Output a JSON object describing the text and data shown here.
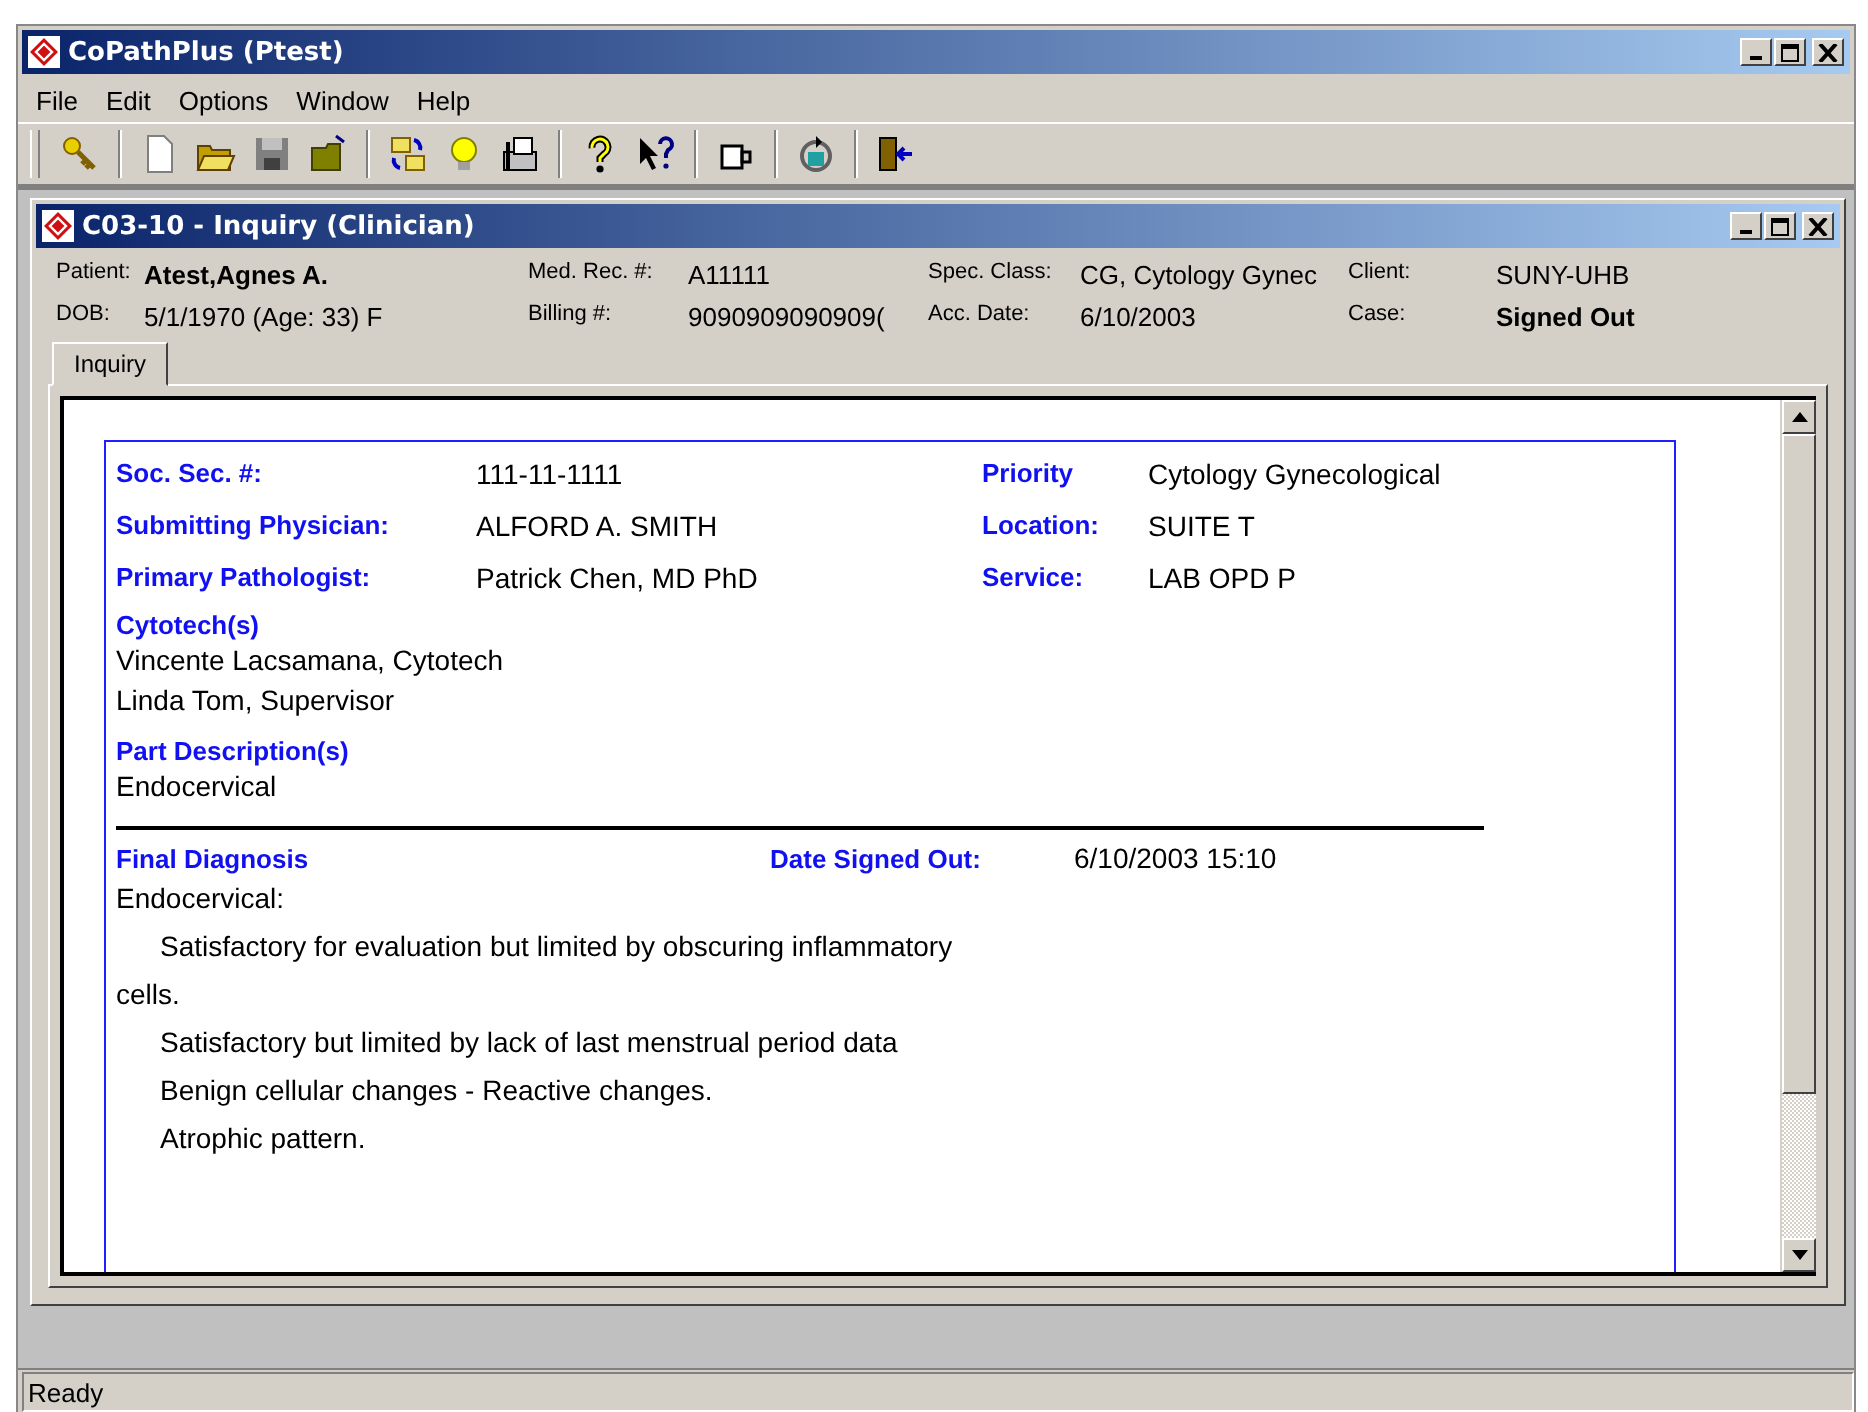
{
  "window": {
    "title": "CoPathPlus (Ptest)"
  },
  "menu": [
    "File",
    "Edit",
    "Options",
    "Window",
    "Help"
  ],
  "toolbar": [
    {
      "kind": "key"
    },
    {
      "kind": "sep"
    },
    {
      "kind": "new"
    },
    {
      "kind": "open"
    },
    {
      "kind": "save"
    },
    {
      "kind": "folder"
    },
    {
      "kind": "sep"
    },
    {
      "kind": "swap"
    },
    {
      "kind": "bulb"
    },
    {
      "kind": "fax"
    },
    {
      "kind": "sep"
    },
    {
      "kind": "help"
    },
    {
      "kind": "pointer"
    },
    {
      "kind": "sep"
    },
    {
      "kind": "cup"
    },
    {
      "kind": "sep"
    },
    {
      "kind": "cycle"
    },
    {
      "kind": "sep"
    },
    {
      "kind": "exit"
    }
  ],
  "child": {
    "title": "C03-10 - Inquiry (Clinician)",
    "header": [
      {
        "label": "Patient:",
        "value": "Atest,Agnes A.",
        "bold": true
      },
      {
        "label": "Med. Rec. #:",
        "value": "A11111",
        "bold": false
      },
      {
        "label": "Spec. Class:",
        "value": "CG, Cytology Gynec",
        "bold": false
      },
      {
        "label": "Client:",
        "value": "SUNY-UHB",
        "bold": false
      },
      {
        "label": "DOB:",
        "value": "5/1/1970 (Age: 33) F",
        "bold": false
      },
      {
        "label": "Billing #:",
        "value": "9090909090909(",
        "bold": false
      },
      {
        "label": "Acc. Date:",
        "value": "6/10/2003",
        "bold": false
      },
      {
        "label": "Case:",
        "value": "Signed Out",
        "bold": true
      }
    ],
    "tabs": [
      {
        "label": "Inquiry",
        "selected": true
      }
    ],
    "fields_left": [
      {
        "label": "Soc. Sec. #:",
        "value": "111-11-1111"
      },
      {
        "label": "Submitting Physician:",
        "value": "ALFORD A. SMITH"
      },
      {
        "label": "Primary Pathologist:",
        "value": "Patrick Chen, MD PhD"
      }
    ],
    "fields_right": [
      {
        "label": "Priority",
        "value": "Cytology Gynecological"
      },
      {
        "label": "Location:",
        "value": "SUITE T"
      },
      {
        "label": "Service:",
        "value": "LAB OPD P"
      }
    ],
    "sections": [
      {
        "heading": "Cytotech(s)",
        "lines": [
          "Vincente Lacsamana, Cytotech",
          "Linda Tom, Supervisor"
        ]
      },
      {
        "heading": "Part Description(s)",
        "lines": [
          "Endocervical"
        ]
      }
    ],
    "diagnosis": {
      "heading": "Final Diagnosis",
      "date_label": "Date Signed Out:",
      "date": "6/10/2003 15:10",
      "lines": [
        {
          "text": "Endocervical:",
          "indent": false
        },
        {
          "text": "Satisfactory for evaluation but limited by obscuring inflammatory",
          "indent": true
        },
        {
          "text": "cells.",
          "indent": false
        },
        {
          "text": "Satisfactory but limited by lack of last menstrual period data",
          "indent": true
        },
        {
          "text": "Benign cellular changes - Reactive changes.",
          "indent": true
        },
        {
          "text": "Atrophic pattern.",
          "indent": true
        }
      ]
    }
  },
  "status_bar": "Ready"
}
